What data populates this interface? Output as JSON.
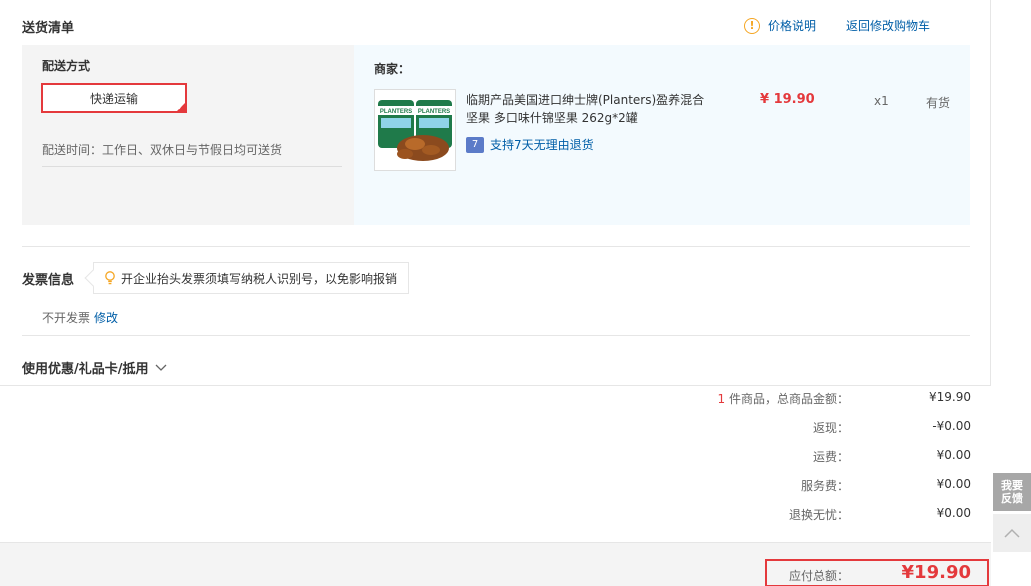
{
  "delivery": {
    "title": "送货清单",
    "price_note": "价格说明",
    "back_to_cart": "返回修改购物车",
    "method_label": "配送方式",
    "method_selected": "快递运输",
    "ship_time": "配送时间：工作日、双休日与节假日均可送货",
    "merchant_label": "商家：",
    "product": {
      "name": "临期产品美国进口绅士牌(Planters)盈养混合坚果 多口味什锦坚果 262g*2罐",
      "return_policy": "支持7天无理由退货",
      "return_icon": "7",
      "price": "¥ 19.90",
      "quantity": "x1",
      "stock": "有货",
      "image_brand": "PLANTERS"
    }
  },
  "invoice": {
    "title": "发票信息",
    "tip": "开企业抬头发票须填写纳税人识别号，以免影响报销",
    "value": "不开发票",
    "edit": "修改"
  },
  "coupon": {
    "label": "使用优惠/礼品卡/抵用"
  },
  "summary": {
    "count": "1",
    "goods_label": "件商品，总商品金额：",
    "goods_value": "¥19.90",
    "cashback_label": "返现：",
    "cashback_value": "-¥0.00",
    "shipping_label": "运费：",
    "shipping_value": "¥0.00",
    "service_label": "服务费：",
    "service_value": "¥0.00",
    "worry_free_label": "退换无忧：",
    "worry_free_value": "¥0.00",
    "total_label": "应付总额：",
    "total_value": "¥19.90"
  },
  "float": {
    "feedback_line1": "我要",
    "feedback_line2": "反馈"
  },
  "colors": {
    "accent_red": "#e4393c",
    "link_blue": "#005ea7",
    "warning_orange": "#f5a623"
  }
}
